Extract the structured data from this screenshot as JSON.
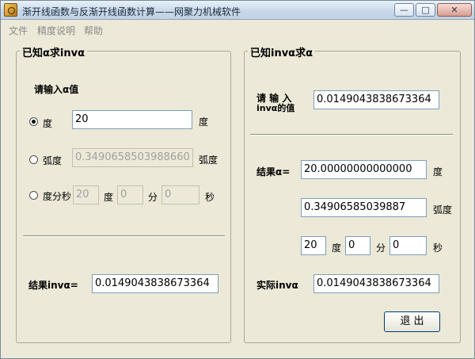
{
  "window": {
    "title": "渐开线函数与反渐开线函数计算——网聚力机械软件",
    "min_glyph": "—",
    "max_glyph": "□",
    "close_glyph": "✕"
  },
  "menu": [
    "文件",
    "精度说明",
    "帮助"
  ],
  "left": {
    "group_title": "已知α求invα",
    "prompt": "请输入α值",
    "deg": {
      "label": "度",
      "value": "20",
      "unit": "度",
      "selected": true
    },
    "rad": {
      "label": "弧度",
      "value": "0.3490658503988660",
      "unit": "弧度"
    },
    "dms": {
      "label": "度分秒",
      "d": "20",
      "d_unit": "度",
      "m": "0",
      "m_unit": "分",
      "s": "0",
      "s_unit": "秒"
    },
    "result_label": "结果invα=",
    "result_value": "0.0149043838673364"
  },
  "right": {
    "group_title": "已知invα求α",
    "prompt_line1": "请 输 入",
    "prompt_line2": "invα的值",
    "input_value": "0.0149043838673364",
    "result_label": "结果α=",
    "result_deg": "20.00000000000000",
    "deg_unit": "度",
    "result_rad": "0.34906585039887",
    "rad_unit": "弧度",
    "dms": {
      "d": "20",
      "d_unit": "度",
      "m": "0",
      "m_unit": "分",
      "s": "0",
      "s_unit": "秒"
    },
    "actual_label": "实际invα",
    "actual_value": "0.0149043838673364",
    "exit_label": "退 出"
  }
}
